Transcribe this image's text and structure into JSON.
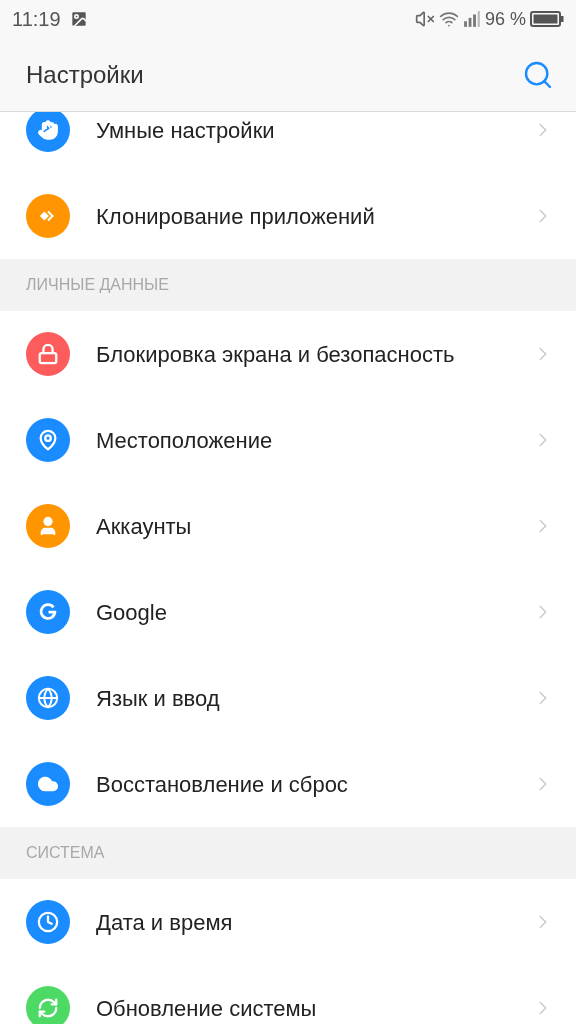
{
  "status_bar": {
    "time": "11:19",
    "battery": "96 %"
  },
  "header": {
    "title": "Настройки"
  },
  "sections": [
    {
      "items": [
        {
          "label": "Умные настройки",
          "color": "#1a8cff"
        },
        {
          "label": "Клонирование приложений",
          "color": "#ff9500"
        }
      ]
    },
    {
      "title": "ЛИЧНЫЕ ДАННЫЕ",
      "items": [
        {
          "label": "Блокировка экрана и безопасность",
          "color": "#fc5c5c"
        },
        {
          "label": "Местоположение",
          "color": "#1a8cff"
        },
        {
          "label": "Аккаунты",
          "color": "#ff9500"
        },
        {
          "label": "Google",
          "color": "#1a8cff"
        },
        {
          "label": "Язык и ввод",
          "color": "#1a8cff"
        },
        {
          "label": "Восстановление и сброс",
          "color": "#1a8cff"
        }
      ]
    },
    {
      "title": "СИСТЕМА",
      "items": [
        {
          "label": "Дата и время",
          "color": "#1a8cff"
        },
        {
          "label": "Обновление системы",
          "color": "#4cd964"
        }
      ]
    }
  ]
}
